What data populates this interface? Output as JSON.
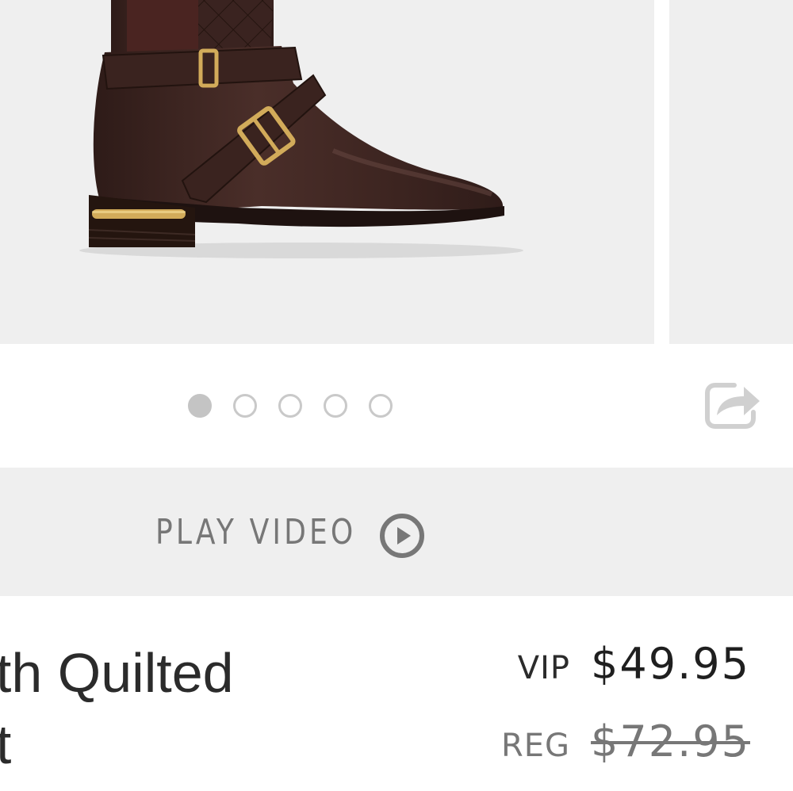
{
  "product": {
    "name_line1": "eth Quilted",
    "name_line2": "ot",
    "image_alt": "brown quilted riding boot with buckle straps"
  },
  "carousel": {
    "slide_count": 5,
    "active_index": 0
  },
  "video": {
    "label": "PLAY VIDEO"
  },
  "pricing": {
    "vip_label": "VIP",
    "vip_price": "$49.95",
    "reg_label": "REG",
    "reg_price": "$72.95"
  },
  "icons": {
    "share": "share-icon",
    "play": "play-circle-icon"
  },
  "colors": {
    "background": "#ffffff",
    "panel": "#efefef",
    "text_dark": "#2b2b2b",
    "text_muted": "#777777",
    "dot": "#c4c4c4",
    "boot_brown": "#3e2622",
    "hardware_gold": "#c9a24a"
  }
}
